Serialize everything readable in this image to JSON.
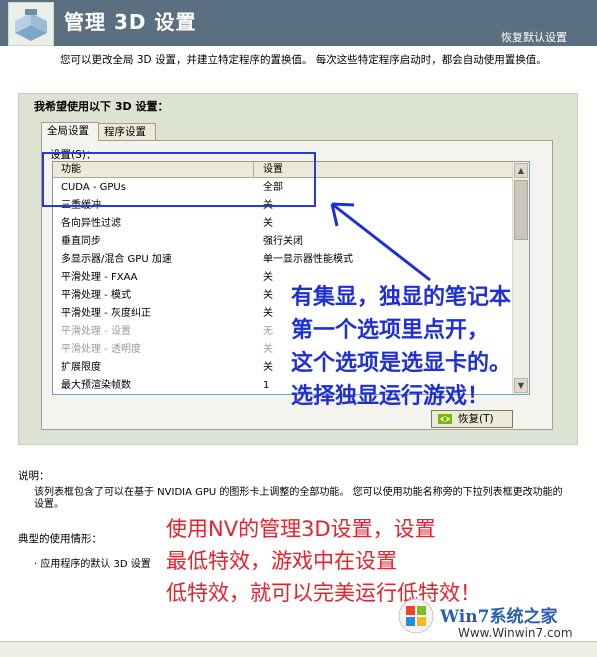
{
  "header": {
    "title": "管理 3D 设置",
    "restore_defaults": "恢复默认设置"
  },
  "description": "您可以更改全局 3D 设置，并建立特定程序的置换值。 每次这些特定程序启动时，都会自动使用置换值。",
  "panel": {
    "title": "我希望使用以下 3D 设置：",
    "tabs": [
      "全局设置",
      "程序设置"
    ],
    "settings_label": "设置(S)：",
    "columns": [
      "功能",
      "设置"
    ],
    "rows": [
      {
        "name": "CUDA - GPUs",
        "value": "全部",
        "disabled": false
      },
      {
        "name": "三重缓冲",
        "value": "关",
        "disabled": false
      },
      {
        "name": "各向异性过滤",
        "value": "关",
        "disabled": false
      },
      {
        "name": "垂直同步",
        "value": "强行关闭",
        "disabled": false
      },
      {
        "name": "多显示器/混合 GPU 加速",
        "value": "单一显示器性能模式",
        "disabled": false
      },
      {
        "name": "平滑处理 - FXAA",
        "value": "关",
        "disabled": false
      },
      {
        "name": "平滑处理 - 模式",
        "value": "关",
        "disabled": false
      },
      {
        "name": "平滑处理 - 灰度纠正",
        "value": "关",
        "disabled": false
      },
      {
        "name": "平滑处理 - 设置",
        "value": "无",
        "disabled": true
      },
      {
        "name": "平滑处理 - 透明度",
        "value": "关",
        "disabled": true
      },
      {
        "name": "扩展限度",
        "value": "关",
        "disabled": false
      },
      {
        "name": "最大预渲染帧数",
        "value": "1",
        "disabled": false
      }
    ],
    "restore_button": "恢复(T)"
  },
  "annotation_blue": [
    "有集显，独显的笔记本",
    "第一个选项里点开，",
    "这个选项是选显卡的。",
    "选择独显运行游戏！"
  ],
  "explanation": {
    "title": "说明：",
    "text": "该列表框包含了可以在基于 NVIDIA GPU 的图形卡上调整的全部功能。 您可以使用功能名称旁的下拉列表框更改功能的设置。"
  },
  "usage": {
    "title": "典型的使用情形：",
    "bullet": "· 应用程序的默认 3D 设置"
  },
  "annotation_red": [
    "使用NV的管理3D设置，设置",
    "最低特效，游戏中在设置",
    "低特效，就可以完美运行低特效！"
  ],
  "watermark": {
    "brand": "Win7系统之家",
    "url": "Www.Winwin7.com"
  },
  "colors": {
    "header_bg": "#5a6f7f",
    "panel_bg": "#dde3d2",
    "annotation_blue": "#1f2fd8",
    "annotation_red": "#e8212b"
  }
}
